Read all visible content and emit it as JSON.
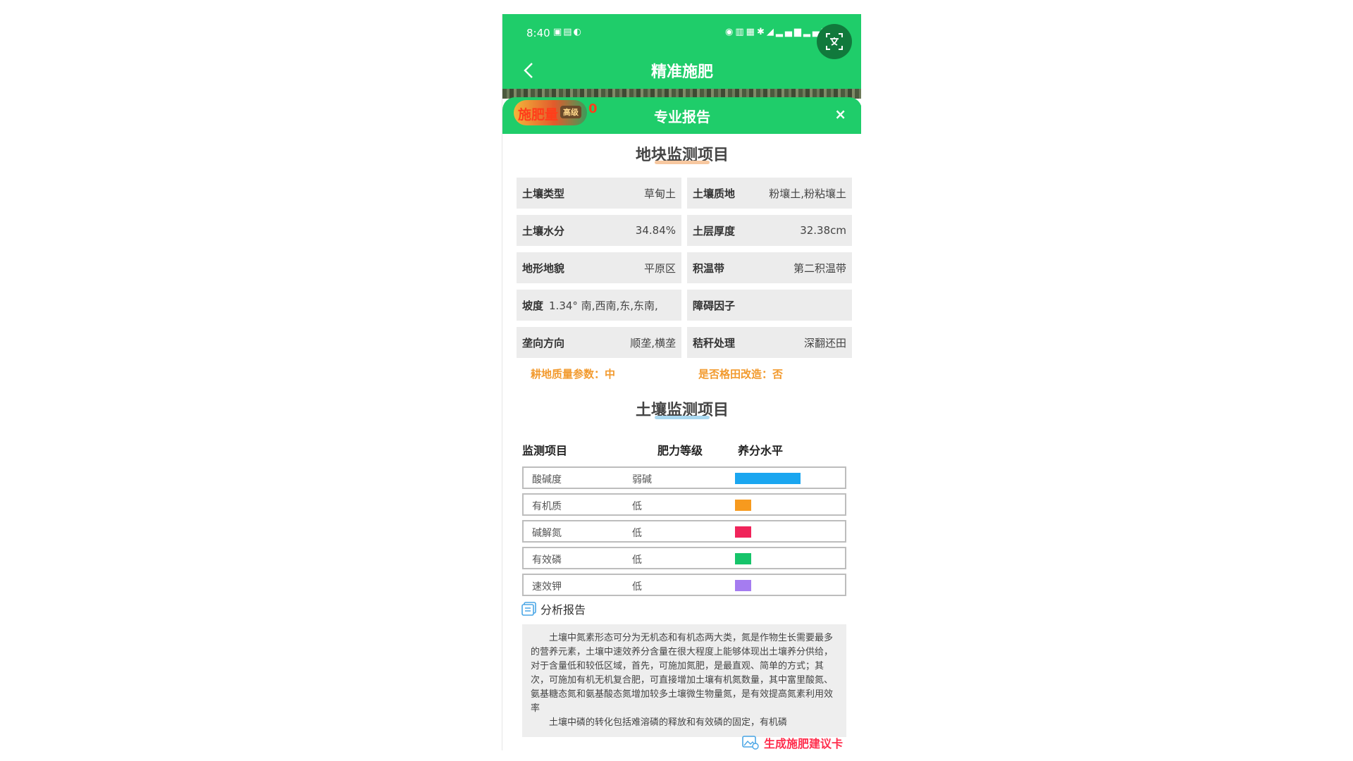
{
  "status_bar": {
    "time": "8:40"
  },
  "nav": {
    "title": "精准施肥"
  },
  "report": {
    "badge": "施肥量",
    "badge_pro": "高级",
    "badge_count": "0",
    "title": "专业报告",
    "close": "×"
  },
  "plot": {
    "title": "地块监测项目",
    "cells": [
      {
        "key": "土壤类型",
        "value": "草甸土"
      },
      {
        "key": "土壤质地",
        "value": "粉壤土,粉粘壤土"
      },
      {
        "key": "土壤水分",
        "value": "34.84%"
      },
      {
        "key": "土层厚度",
        "value": "32.38cm"
      },
      {
        "key": "地形地貌",
        "value": "平原区"
      },
      {
        "key": "积温带",
        "value": "第二积温带"
      },
      {
        "key": "坡度",
        "value": "1.34° 南,西南,东,东南,"
      },
      {
        "key": "障碍因子",
        "value": ""
      },
      {
        "key": "垄向方向",
        "value": "顺垄,横垄"
      },
      {
        "key": "秸秆处理",
        "value": "深翻还田"
      }
    ],
    "note_quality": "耕地质量参数：中",
    "note_grid": "是否格田改造：否"
  },
  "soil": {
    "title": "土壤监测项目",
    "headers": {
      "item": "监测项目",
      "grade": "肥力等级",
      "level": "养分水平"
    },
    "rows": [
      {
        "name": "酸碱度",
        "grade": "弱碱",
        "level_fraction": 0.81,
        "color": "#1aa6f0"
      },
      {
        "name": "有机质",
        "grade": "低",
        "level_fraction": 0.2,
        "color": "#f79a1e"
      },
      {
        "name": "碱解氮",
        "grade": "低",
        "level_fraction": 0.2,
        "color": "#f0245a"
      },
      {
        "name": "有效磷",
        "grade": "低",
        "level_fraction": 0.2,
        "color": "#16c46a"
      },
      {
        "name": "速效钾",
        "grade": "低",
        "level_fraction": 0.2,
        "color": "#a57cf0"
      }
    ]
  },
  "analysis": {
    "title": "分析报告",
    "paragraph1": "土壤中氮素形态可分为无机态和有机态两大类，氮是作物生长需要最多的营养元素，土壤中速效养分含量在很大程度上能够体现出土壤养分供给，对于含量低和较低区域，首先，可施加氮肥，是最直观、简单的方式；其次，可施加有机无机复合肥，可直接增加土壤有机氮数量，其中富里酸氮、氨基糖态氮和氨基酸态氮增加较多土壤微生物量氮，是有效提高氮素利用效率",
    "paragraph2": "土壤中磷的转化包括难溶磷的释放和有效磷的固定，有机磷"
  },
  "actions": {
    "generate": "生成施肥建议卡"
  },
  "colors": {
    "primary": "#1fcd6a",
    "orange": "#f29a2e",
    "accent_red": "#ff2e4d"
  }
}
